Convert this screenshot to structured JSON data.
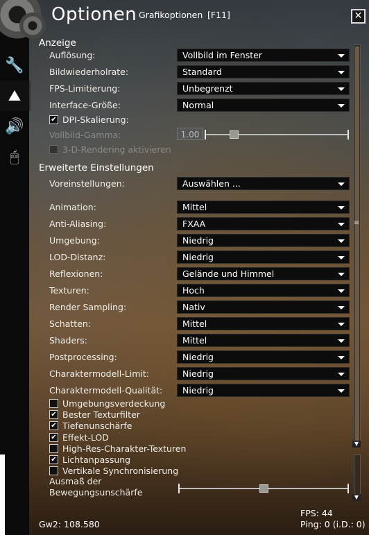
{
  "header": {
    "title": "Optionen",
    "subtitle": "Grafikoptionen",
    "hotkey": "[F11]",
    "close_label": "✕"
  },
  "sidebar": {
    "tabs": [
      {
        "icon": "wrench-icon",
        "glyph": "🔧",
        "active": false
      },
      {
        "icon": "mountain-icon",
        "glyph": "⛰",
        "active": true
      },
      {
        "icon": "speaker-icon",
        "glyph": "🔊",
        "active": false
      },
      {
        "icon": "mouse-icon",
        "glyph": "🖱",
        "active": false
      }
    ]
  },
  "anzeige": {
    "heading": "Anzeige",
    "aufloesung": {
      "label": "Auflösung:",
      "value": "Vollbild im Fenster"
    },
    "wiederholrate": {
      "label": "Bildwiederholrate:",
      "value": "Standard"
    },
    "fps_limit": {
      "label": "FPS-Limitierung:",
      "value": "Unbegrenzt"
    },
    "interface": {
      "label": "Interface-Größe:",
      "value": "Normal"
    },
    "dpi": {
      "label": "DPI-Skalierung:",
      "checked": true
    },
    "gamma": {
      "label": "Vollbild-Gamma:",
      "value": "1.00",
      "level": 0.2
    },
    "render3d": {
      "label": "3-D-Rendering aktivieren",
      "checked": true
    }
  },
  "erweitert": {
    "heading": "Erweiterte Einstellungen",
    "preset": {
      "label": "Voreinstellungen:",
      "value": "Auswählen ..."
    },
    "rows": [
      {
        "label": "Animation:",
        "value": "Mittel"
      },
      {
        "label": "Anti-Aliasing:",
        "value": "FXAA"
      },
      {
        "label": "Umgebung:",
        "value": "Niedrig"
      },
      {
        "label": "LOD-Distanz:",
        "value": "Niedrig"
      },
      {
        "label": "Reflexionen:",
        "value": "Gelände und Himmel"
      },
      {
        "label": "Texturen:",
        "value": "Hoch"
      },
      {
        "label": "Render Sampling:",
        "value": "Nativ"
      },
      {
        "label": "Schatten:",
        "value": "Mittel"
      },
      {
        "label": "Shaders:",
        "value": "Mittel"
      },
      {
        "label": "Postprocessing:",
        "value": "Niedrig"
      },
      {
        "label": "Charaktermodell-Limit:",
        "value": "Niedrig"
      },
      {
        "label": "Charaktermodell-Qualität:",
        "value": "Niedrig"
      }
    ],
    "checkboxes": [
      {
        "label": "Umgebungsverdeckung",
        "checked": false
      },
      {
        "label": "Bester Texturfilter",
        "checked": true
      },
      {
        "label": "Tiefenunschärfe",
        "checked": true
      },
      {
        "label": "Effekt-LOD",
        "checked": true
      },
      {
        "label": "High-Res-Charakter-Texturen",
        "checked": false
      },
      {
        "label": "Lichtanpassung",
        "checked": true
      },
      {
        "label": "Vertikale Synchronisierung",
        "checked": false
      }
    ],
    "motion_blur": {
      "label_line1": "Ausmaß der",
      "label_line2": "Bewegungsunschärfe",
      "level": 0.5
    }
  },
  "footer": {
    "build": "Gw2: 108.580",
    "fps": "FPS: 44",
    "ping": "Ping: 0 (i.D.: 0)"
  }
}
